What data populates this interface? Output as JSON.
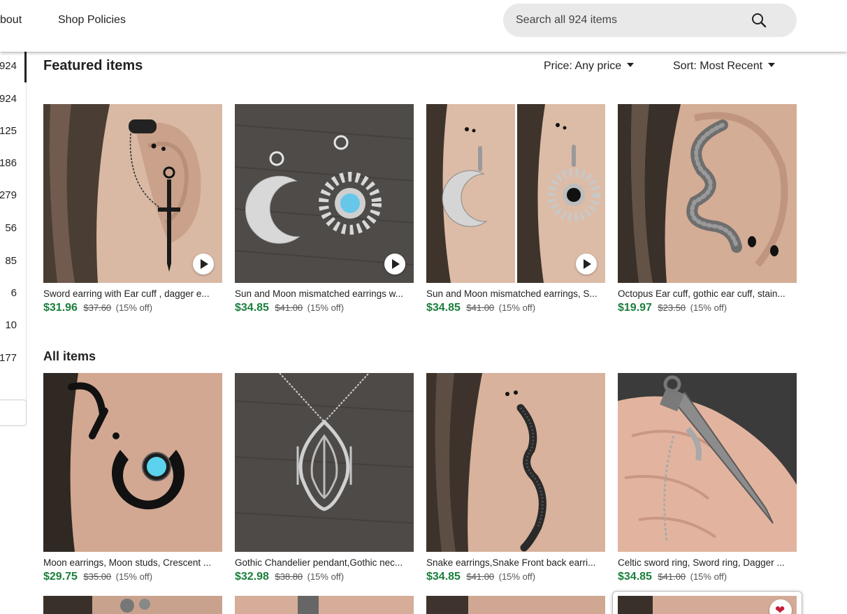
{
  "nav": {
    "about": "bout",
    "shop_policies": "Shop Policies"
  },
  "search": {
    "placeholder": "Search all 924 items"
  },
  "sidebar": {
    "counts": [
      "924",
      "924",
      "125",
      "186",
      "279",
      "56",
      "85",
      "6",
      "10",
      "177"
    ]
  },
  "featured": {
    "title": "Featured items",
    "price_filter": "Price: Any price",
    "sort": "Sort: Most Recent",
    "items": [
      {
        "title": "Sword earring with Ear cuff , dagger e...",
        "price": "$31.96",
        "original": "$37.60",
        "discount": "(15% off)",
        "has_video": true
      },
      {
        "title": "Sun and Moon mismatched earrings w...",
        "price": "$34.85",
        "original": "$41.00",
        "discount": "(15% off)",
        "has_video": true
      },
      {
        "title": "Sun and Moon mismatched earrings, S...",
        "price": "$34.85",
        "original": "$41.00",
        "discount": "(15% off)",
        "has_video": true
      },
      {
        "title": "Octopus Ear cuff, gothic ear cuff, stain...",
        "price": "$19.97",
        "original": "$23.50",
        "discount": "(15% off)",
        "has_video": false
      }
    ]
  },
  "all_items": {
    "title": "All items",
    "items": [
      {
        "title": "Moon earrings, Moon studs, Crescent ...",
        "price": "$29.75",
        "original": "$35.00",
        "discount": "(15% off)"
      },
      {
        "title": "Gothic Chandelier pendant,Gothic nec...",
        "price": "$32.98",
        "original": "$38.80",
        "discount": "(15% off)"
      },
      {
        "title": "Snake earrings,Snake Front back earri...",
        "price": "$34.85",
        "original": "$41.00",
        "discount": "(15% off)"
      },
      {
        "title": "Celtic sword ring, Sword ring, Dagger ...",
        "price": "$34.85",
        "original": "$41.00",
        "discount": "(15% off)"
      }
    ]
  },
  "icons": {
    "search": "search-icon",
    "play": "play-icon",
    "heart": "heart-icon",
    "caret": "caret-down-icon"
  },
  "colors": {
    "sale_price": "#1a7f3c",
    "favorite": "#c41e3a",
    "search_bg": "#e9e9e9"
  }
}
